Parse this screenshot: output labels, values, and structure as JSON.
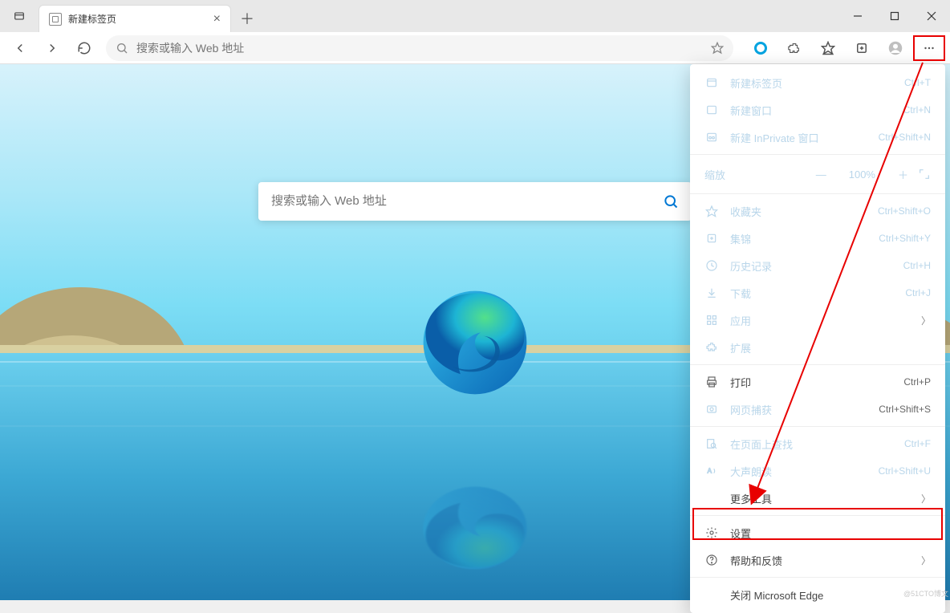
{
  "tab": {
    "title": "新建标签页"
  },
  "omnibox": {
    "placeholder": "搜索或输入 Web 地址"
  },
  "ntp_search": {
    "placeholder": "搜索或输入 Web 地址"
  },
  "menu": {
    "new_tab": {
      "label": "新建标签页",
      "shortcut": "Ctrl+T"
    },
    "new_window": {
      "label": "新建窗口",
      "shortcut": "Ctrl+N"
    },
    "new_inprivate": {
      "label": "新建 InPrivate 窗口",
      "shortcut": "Ctrl+Shift+N"
    },
    "zoom": {
      "label": "缩放",
      "value": "100%"
    },
    "favorites": {
      "label": "收藏夹",
      "shortcut": "Ctrl+Shift+O"
    },
    "collections": {
      "label": "集锦",
      "shortcut": "Ctrl+Shift+Y"
    },
    "history": {
      "label": "历史记录",
      "shortcut": "Ctrl+H"
    },
    "downloads": {
      "label": "下载",
      "shortcut": "Ctrl+J"
    },
    "apps": {
      "label": "应用"
    },
    "extensions": {
      "label": "扩展"
    },
    "print": {
      "label": "打印",
      "shortcut": "Ctrl+P"
    },
    "webcapture": {
      "label": "网页捕获",
      "shortcut": "Ctrl+Shift+S"
    },
    "find": {
      "label": "在页面上查找",
      "shortcut": "Ctrl+F"
    },
    "read_aloud": {
      "label": "大声朗读",
      "shortcut": "Ctrl+Shift+U"
    },
    "more_tools": {
      "label": "更多工具"
    },
    "settings": {
      "label": "设置"
    },
    "help": {
      "label": "帮助和反馈"
    },
    "close": {
      "label": "关闭 Microsoft Edge"
    }
  },
  "watermark": "@51CTO博文"
}
